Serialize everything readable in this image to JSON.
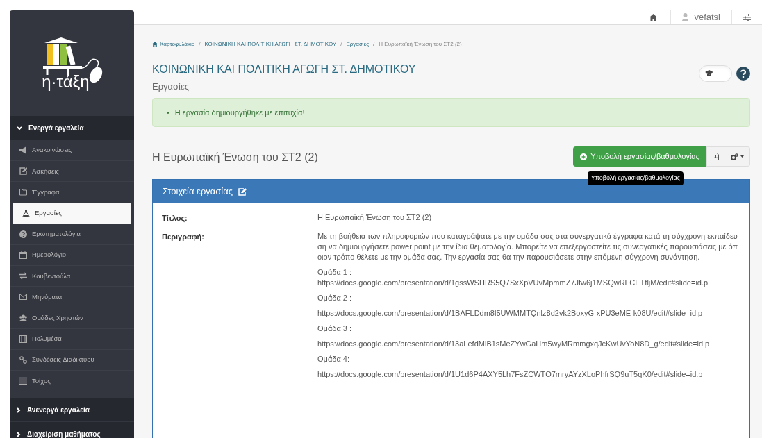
{
  "sidebar": {
    "logo_text": "η·τάξη",
    "sections": [
      {
        "label": "Ενεργά εργαλεία",
        "expanded": true,
        "items": [
          {
            "label": "Ανακοινώσεις",
            "selected": false
          },
          {
            "label": "Ασκήσεις",
            "selected": false
          },
          {
            "label": "Έγγραφα",
            "selected": false
          },
          {
            "label": "Εργασίες",
            "selected": true
          },
          {
            "label": "Ερωτηματολόγια",
            "selected": false
          },
          {
            "label": "Ημερολόγιο",
            "selected": false
          },
          {
            "label": "Κουβεντούλα",
            "selected": false
          },
          {
            "label": "Μηνύματα",
            "selected": false
          },
          {
            "label": "Ομάδες Χρηστών",
            "selected": false
          },
          {
            "label": "Πολυμέσα",
            "selected": false
          },
          {
            "label": "Συνδέσεις Διαδικτύου",
            "selected": false
          },
          {
            "label": "Τοίχος",
            "selected": false
          }
        ]
      },
      {
        "label": "Ανενεργά εργαλεία",
        "expanded": false
      },
      {
        "label": "Διαχείριση μαθήματος",
        "expanded": false
      }
    ]
  },
  "teacher_view": {
    "on": false
  },
  "breadcrumb_separator": "/",
  "top_bar": {
    "username": "vefatsi"
  },
  "breadcrumb": [
    "Χαρτοφυλάκιο",
    "ΚΟΙΝΩΝΙΚΗ ΚΑΙ ΠΟΛΙΤΙΚΗ ΑΓΩΓΗ ΣΤ. ΔΗΜΟΤΙΚΟΥ",
    "Εργασίες",
    "Η Ευρωπαϊκή Ένωση του ΣΤ2 (2)"
  ],
  "page_title": "ΚΟΙΝΩΝΙΚΗ ΚΑΙ ΠΟΛΙΤΙΚΗ ΑΓΩΓΗ ΣΤ. ΔΗΜΟΤΙΚΟΥ",
  "page_subtitle": "Εργασίες",
  "alert": {
    "bullet": "•",
    "messages": [
      "Η εργασία δημιουργήθηκε με επιτυχία!"
    ]
  },
  "assignment_title": "Η Ευρωπαϊκή Ένωση του ΣΤ2 (2)",
  "submit_button": "Υποβολή εργασίας/βαθμολογίας",
  "tooltip": "Υποβολή εργασίας/βαθμολογίας",
  "panel": {
    "title": "Στοιχεία εργασίας",
    "rows": [
      {
        "label": "Τίτλος:",
        "lines": [
          "Η Ευρωπαϊκή Ένωση του ΣΤ2 (2)"
        ]
      },
      {
        "label": "Περιγραφή:",
        "lines": [
          "Με τη βοήθεια των πληροφοριών που καταγράψατε με την ομάδα σας στα συνεργατικά έγγραφα κατά τη σύγχρονη εκπαίδευση να δημιουργήσετε power point με την ίδια θεματολογία. Μπορείτε να επεξεργαστείτε τις συνεργατικές παρουσιάσεις με όποιον τρόπο θέλετε με την ομάδα σας. Την εργασία σας θα την παρουσιάσετε στην επόμενη σύγχρονη συνάντηση.",
          "Ομάδα 1 :\nhttps://docs.google.com/presentation/d/1gssWSHRS5Q7SxXpVUvMpmmZ7Jfw6j1MSQwRFCETfljM/edit#slide=id.p",
          "Ομάδα 2 :",
          "https://docs.google.com/presentation/d/1BAFLDdm8l5UWMMTQnlz8d2vk2BoxyG-xPU3eME-k08U/edit#slide=id.p",
          "Ομάδα 3 :",
          "https://docs.google.com/presentation/d/13aLefdMiB1sMeZYwGaHm5wyMRmmgxqJcKwUvYoN8D_g/edit#slide=id.p",
          "Ομάδα 4:",
          "https://docs.google.com/presentation/d/1U1d6P4AXY5Lh7FsZCWTO7mryAYzXLoPhfrSQ9uT5qK0/edit#slide=id.p"
        ]
      }
    ]
  }
}
